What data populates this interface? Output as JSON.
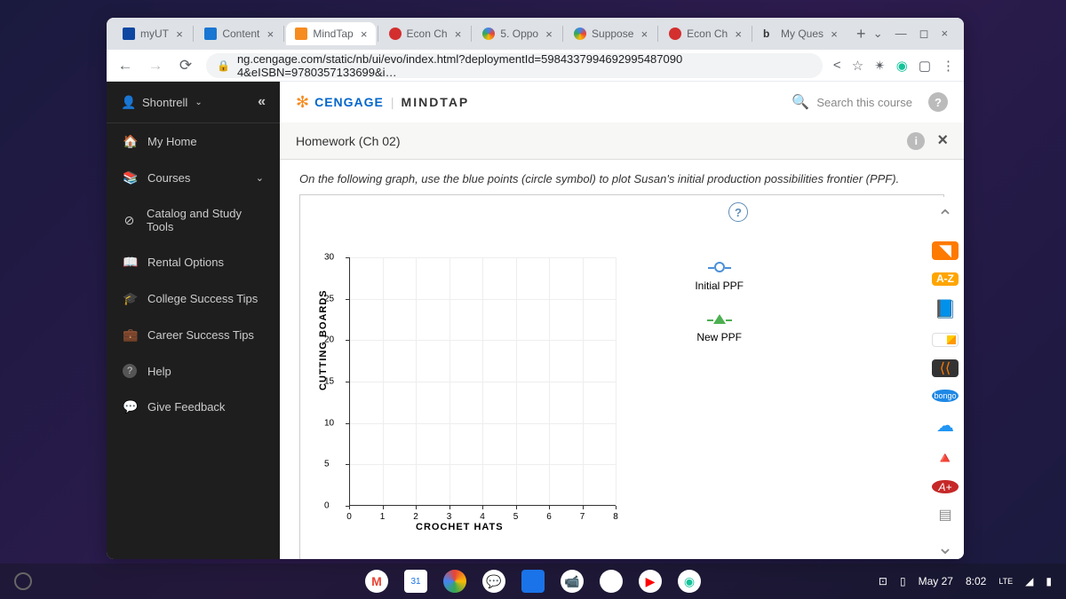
{
  "tabs": [
    {
      "label": "myUT",
      "icon_color": "#0d47a1"
    },
    {
      "label": "Content",
      "icon_color": "#1976d2"
    },
    {
      "label": "MindTap",
      "icon_color": "#f68b1f",
      "active": true
    },
    {
      "label": "Econ Ch",
      "icon_color": "#d32f2f"
    },
    {
      "label": "5. Oppo",
      "icon_color": "#4285f4"
    },
    {
      "label": "Suppose",
      "icon_color": "#4285f4"
    },
    {
      "label": "Econ Ch",
      "icon_color": "#d32f2f"
    },
    {
      "label": "My Ques",
      "icon_color": "#333"
    }
  ],
  "url": "ng.cengage.com/static/nb/ui/evo/index.html?deploymentId=5984337994692995487090​4&eISBN=9780357133699&i…",
  "sidebar": {
    "user": "Shontrell",
    "items": [
      {
        "icon": "🏠",
        "label": "My Home"
      },
      {
        "icon": "📚",
        "label": "Courses",
        "chev": true
      },
      {
        "icon": "⊘",
        "label": "Catalog and Study Tools"
      },
      {
        "icon": "📖",
        "label": "Rental Options"
      },
      {
        "icon": "🎓",
        "label": "College Success Tips"
      },
      {
        "icon": "💼",
        "label": "Career Success Tips"
      },
      {
        "icon": "?",
        "label": "Help"
      },
      {
        "icon": "💬",
        "label": "Give Feedback"
      }
    ]
  },
  "brand": {
    "cengage": "CENGAGE",
    "mindtap": "MINDTAP"
  },
  "search_placeholder": "Search this course",
  "hw_title": "Homework (Ch 02)",
  "instruction": "On the following graph, use the blue points (circle symbol) to plot Susan's initial production possibilities frontier (PPF).",
  "chart_data": {
    "type": "scatter",
    "xlabel": "CROCHET HATS",
    "ylabel": "CUTTING BOARDS",
    "xlim": [
      0,
      8
    ],
    "ylim": [
      0,
      30
    ],
    "xticks": [
      0,
      1,
      2,
      3,
      4,
      5,
      6,
      7,
      8
    ],
    "yticks": [
      0,
      5,
      10,
      15,
      20,
      25,
      30
    ],
    "series": [
      {
        "name": "Initial PPF",
        "marker": "circle",
        "color": "#4a90d9",
        "values": []
      },
      {
        "name": "New PPF",
        "marker": "triangle",
        "color": "#4caf50",
        "values": []
      }
    ]
  },
  "right_tools": {
    "az": "A-Z",
    "bongo": "bongo",
    "aplus": "A+"
  },
  "taskbar": {
    "date": "May 27",
    "time": "8:02"
  }
}
